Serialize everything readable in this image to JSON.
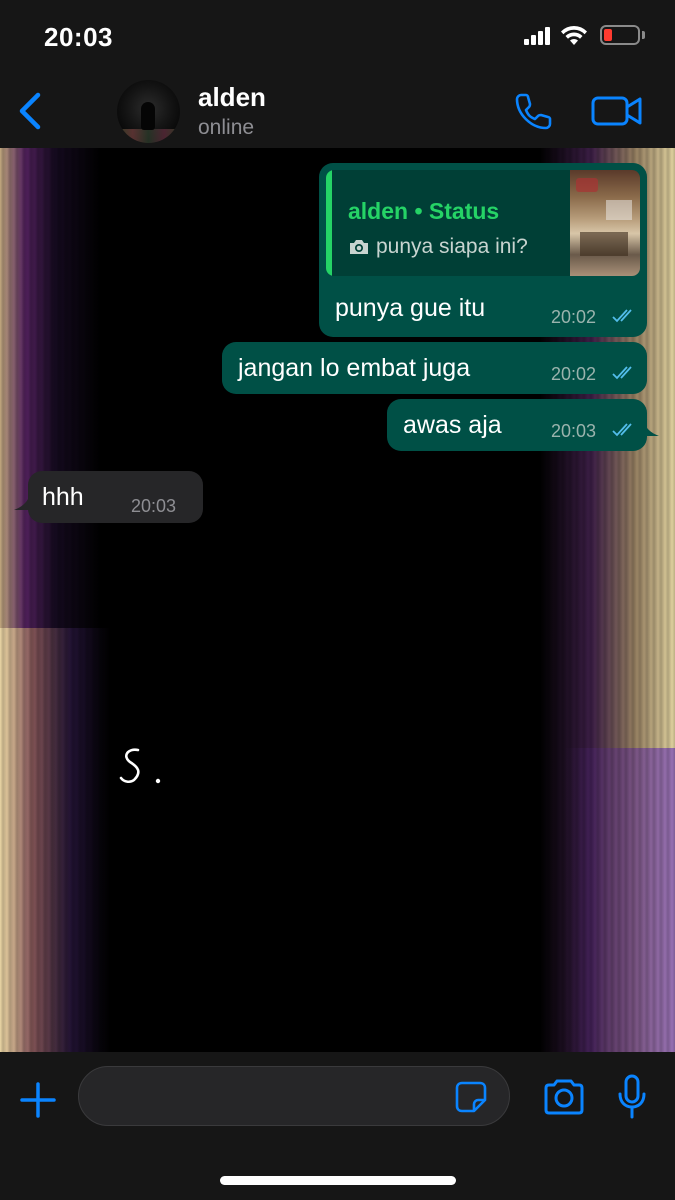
{
  "status_bar": {
    "time": "20:03",
    "signal_icon": "signal-bars",
    "wifi_icon": "wifi",
    "battery_icon": "battery-low",
    "battery_color": "#ff3b30"
  },
  "header": {
    "back_icon": "chevron-left",
    "contact_name": "alden",
    "contact_status": "online",
    "call_icon": "phone",
    "video_icon": "video-camera",
    "accent_color": "#0a84ff"
  },
  "messages": [
    {
      "direction": "outgoing",
      "quote": {
        "author": "alden • Status",
        "text": "punya siapa ini?",
        "icon": "camera"
      },
      "text": "punya gue itu",
      "time": "20:02",
      "status": "read"
    },
    {
      "direction": "outgoing",
      "text": "jangan lo embat juga",
      "time": "20:02",
      "status": "read"
    },
    {
      "direction": "outgoing",
      "text": "awas aja",
      "time": "20:03",
      "status": "read"
    },
    {
      "direction": "incoming",
      "text": "hhh",
      "time": "20:03"
    }
  ],
  "wallpaper": {
    "signature": "S."
  },
  "input_bar": {
    "plus_icon": "plus",
    "placeholder": "",
    "sticker_icon": "sticker",
    "camera_icon": "camera",
    "mic_icon": "microphone"
  },
  "colors": {
    "outgoing_bubble": "#005046",
    "incoming_bubble": "#262628",
    "quote_accent": "#25d366",
    "read_ticks": "#53bdeb"
  }
}
